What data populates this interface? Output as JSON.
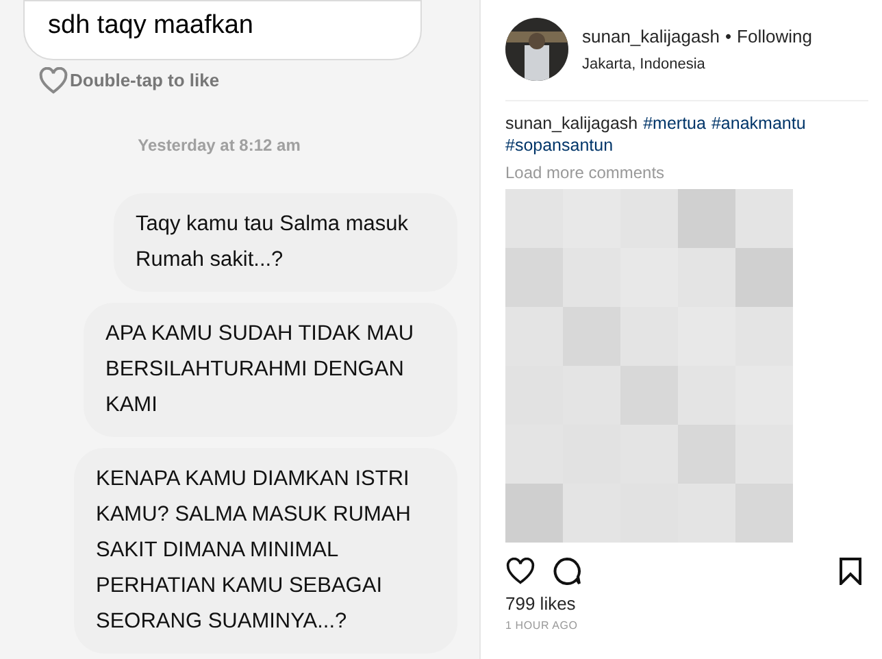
{
  "chat": {
    "messages": [
      {
        "kind": "received",
        "text": "sdh taqy maafkan",
        "like_hint": "Double-tap to like"
      },
      {
        "kind": "timestamp",
        "text": "Yesterday at 8:12 am"
      },
      {
        "kind": "sent",
        "text": "Taqy kamu tau Salma masuk Rumah sakit...?"
      },
      {
        "kind": "sent",
        "text": "APA KAMU SUDAH TIDAK MAU BERSILAHTURAHMI DENGAN KAMI"
      },
      {
        "kind": "sent",
        "text": "KENAPA KAMU DIAMKAN ISTRI KAMU? SALMA MASUK RUMAH SAKIT DIMANA MINIMAL PERHATIAN KAMU SEBAGAI SEORANG SUAMINYA...?"
      }
    ]
  },
  "post": {
    "username": "sunan_kalijagash",
    "separator": "•",
    "follow_status": "Following",
    "location": "Jakarta, Indonesia",
    "caption": {
      "username": "sunan_kalijagash",
      "hashtags": [
        "#mertua",
        "#anakmantu",
        "#sopansantun"
      ]
    },
    "load_more": "Load more comments",
    "likes": "799 likes",
    "time": "1 HOUR AGO"
  }
}
